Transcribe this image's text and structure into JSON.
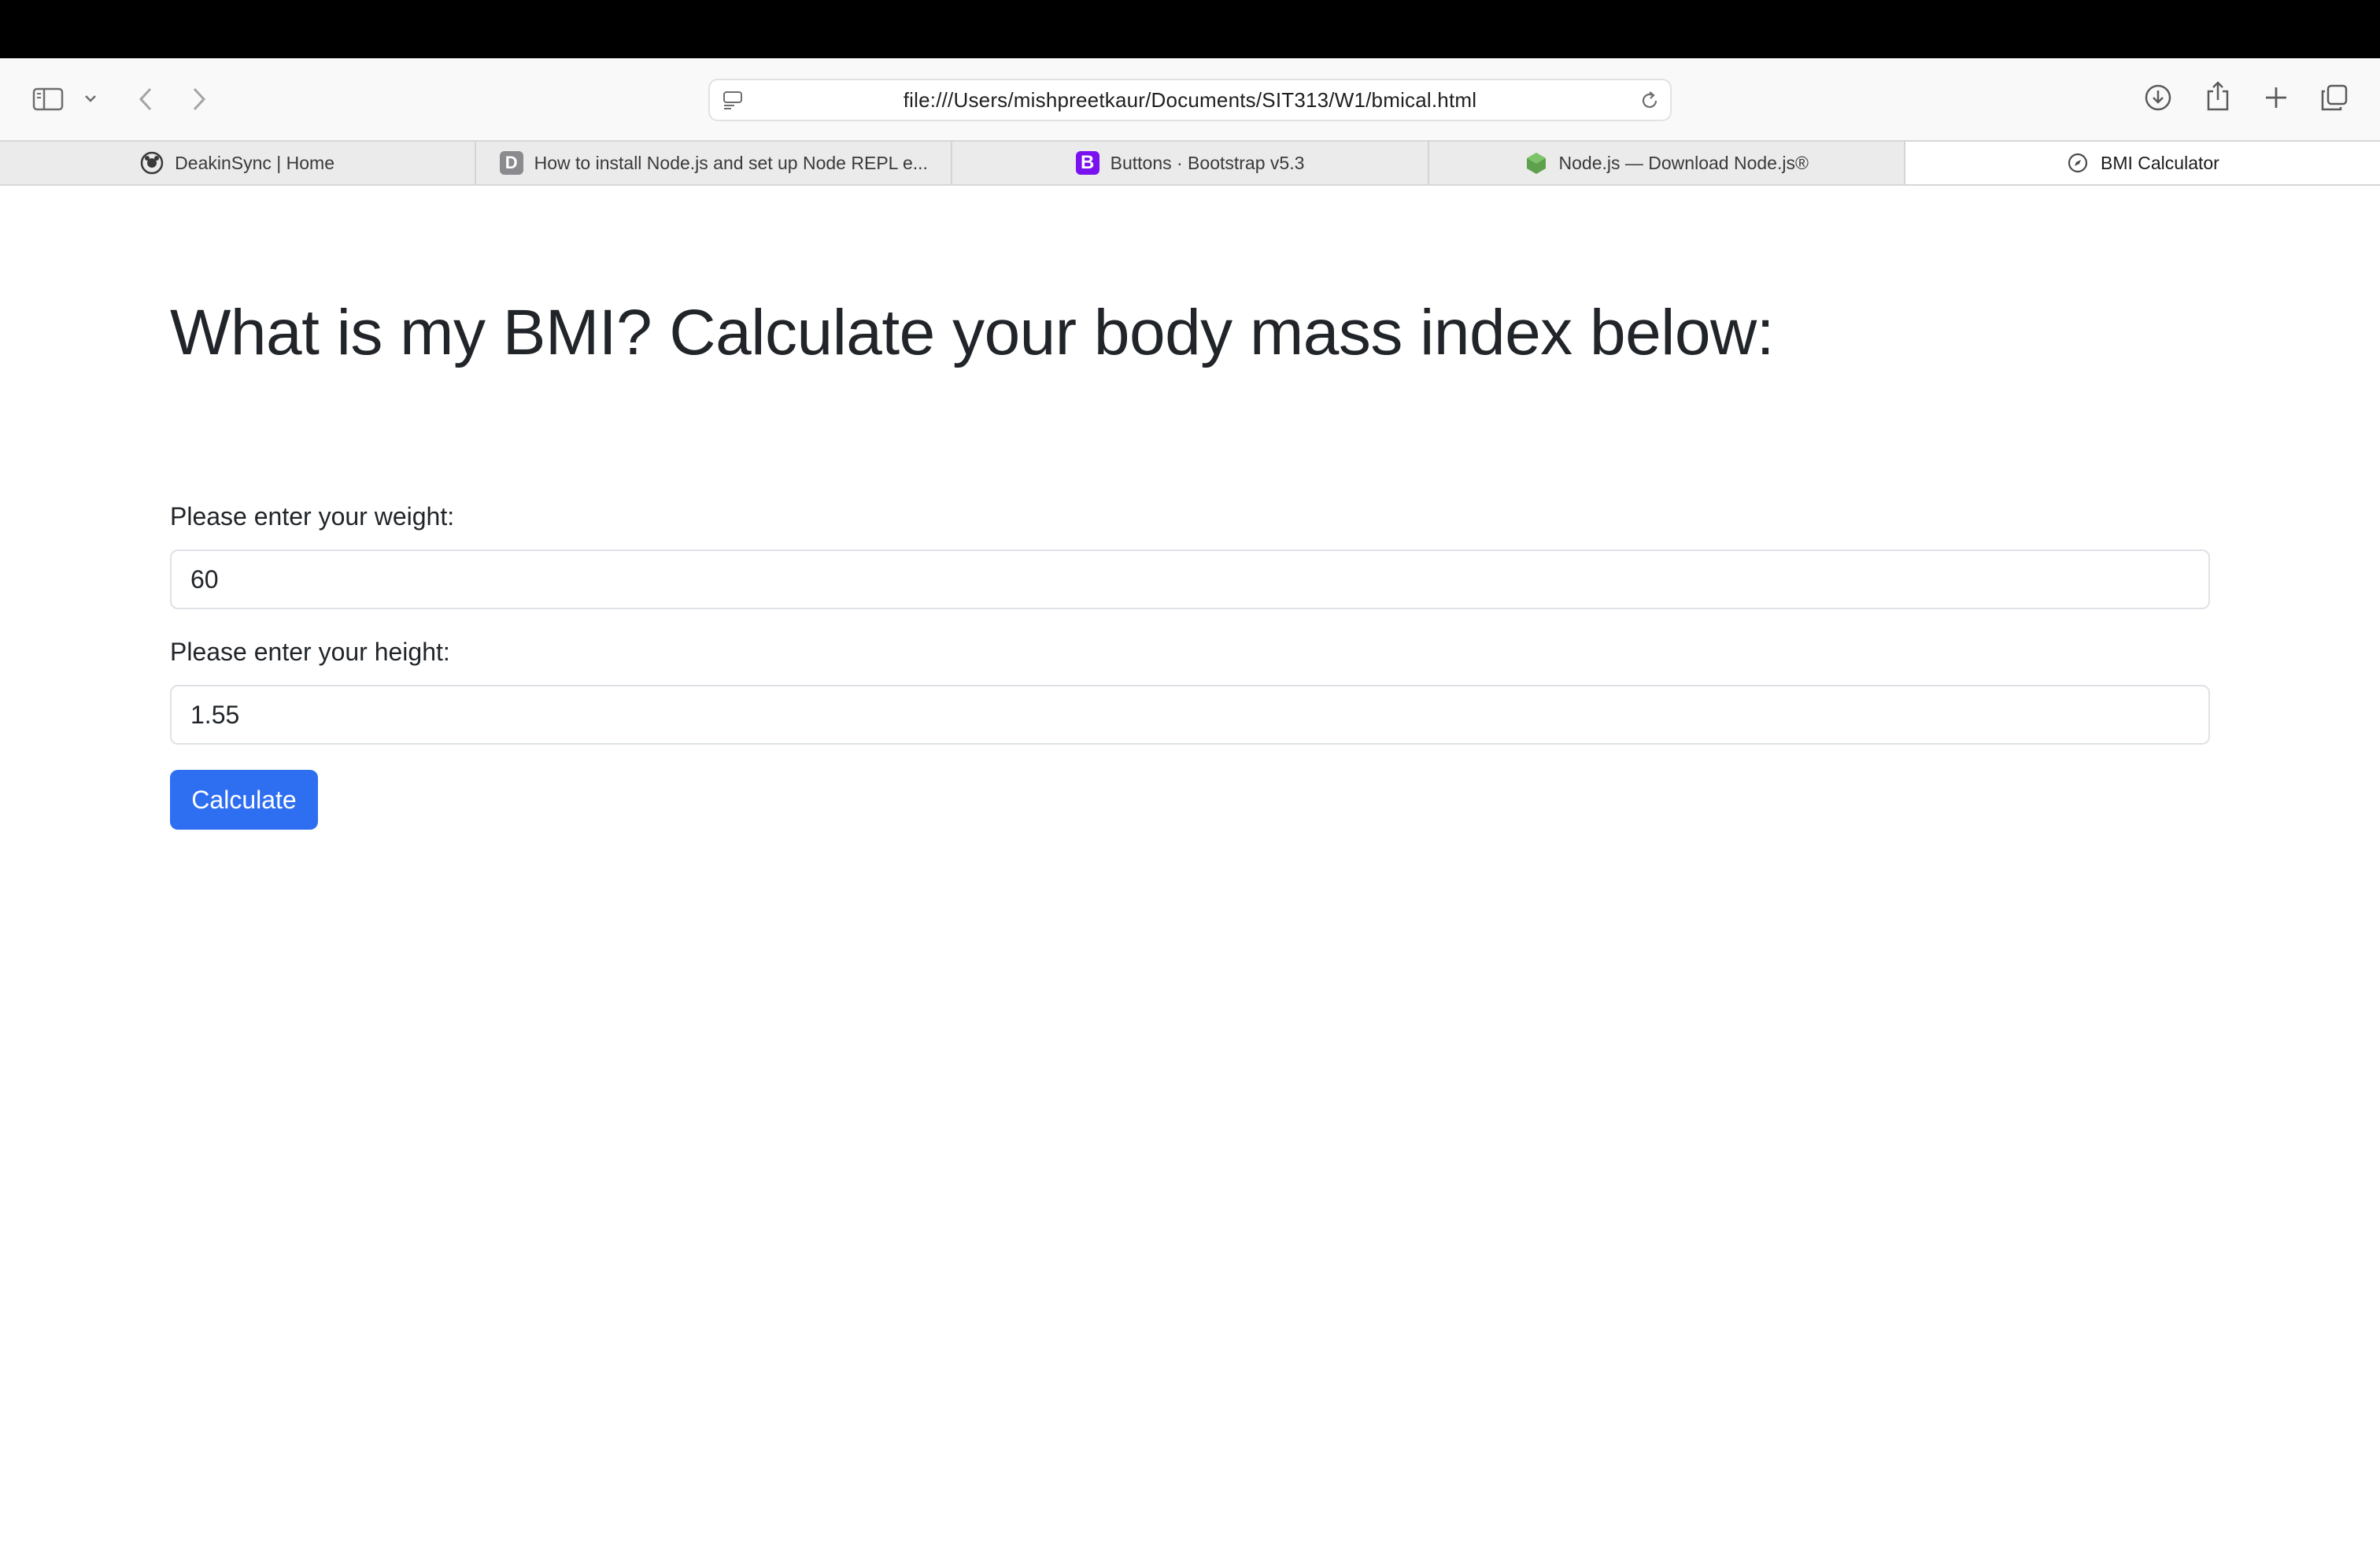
{
  "browser": {
    "address_url": "file:///Users/mishpreetkaur/Documents/SIT313/W1/bmical.html",
    "icons": {
      "sidebar": "sidebar-icon",
      "sidebar_menu": "chevron-down-icon",
      "back": "chevron-left-icon",
      "forward": "chevron-right-icon",
      "page_menu": "page-settings-icon",
      "reload": "reload-icon",
      "downloads": "download-icon",
      "share": "share-icon",
      "new_tab": "plus-icon",
      "tab_overview": "tab-overview-icon"
    }
  },
  "tabs": [
    {
      "label": "DeakinSync | Home",
      "favicon": "deakin-icon",
      "active": false
    },
    {
      "label": "How to install Node.js and set up Node REPL e...",
      "favicon": "d-icon",
      "favicon_text": "D",
      "active": false
    },
    {
      "label": "Buttons · Bootstrap v5.3",
      "favicon": "bootstrap-icon",
      "favicon_text": "B",
      "active": false
    },
    {
      "label": "Node.js — Download Node.js®",
      "favicon": "nodejs-icon",
      "active": false
    },
    {
      "label": "BMI Calculator",
      "favicon": "compass-icon",
      "active": true
    }
  ],
  "page": {
    "heading": "What is my BMI? Calculate your body mass index below:",
    "weight_label": "Please enter your weight:",
    "weight_value": "60",
    "height_label": "Please enter your height:",
    "height_value": "1.55",
    "calculate_label": "Calculate"
  },
  "colors": {
    "primary_button": "#2e6ff2",
    "bootstrap_favicon": "#7a12f0",
    "nodejs_favicon": "#5fa04e"
  }
}
